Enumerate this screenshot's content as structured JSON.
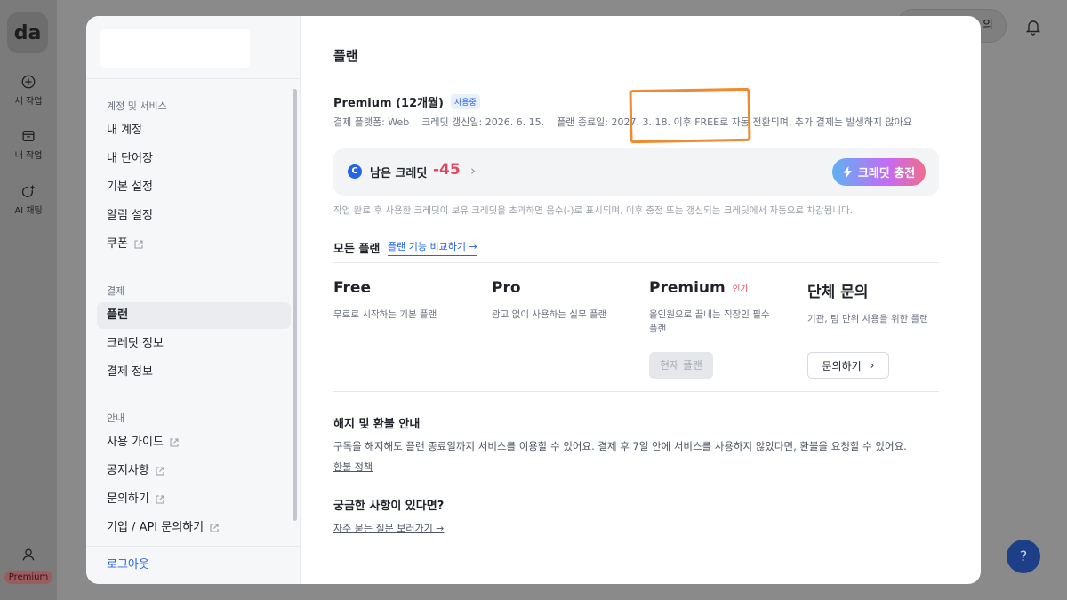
{
  "app": {
    "logo_text": "da",
    "rail": [
      {
        "label": "새 작업",
        "icon": "plus-circle-icon"
      },
      {
        "label": "내 작업",
        "icon": "archive-icon"
      },
      {
        "label": "AI 채팅",
        "icon": "sparkle-chat-icon"
      }
    ],
    "plan_badge": "Premium",
    "top_pill_text": "의"
  },
  "sidebar": {
    "sections": [
      {
        "title": "계정 및 서비스",
        "items": [
          {
            "label": "내 계정",
            "external": false
          },
          {
            "label": "내 단어장",
            "external": false
          },
          {
            "label": "기본 설정",
            "external": false
          },
          {
            "label": "알림 설정",
            "external": false
          },
          {
            "label": "쿠폰",
            "external": true
          }
        ]
      },
      {
        "title": "결제",
        "items": [
          {
            "label": "플랜",
            "external": false,
            "active": true
          },
          {
            "label": "크레딧 정보",
            "external": false
          },
          {
            "label": "결제 정보",
            "external": false
          }
        ]
      },
      {
        "title": "안내",
        "items": [
          {
            "label": "사용 가이드",
            "external": true
          },
          {
            "label": "공지사항",
            "external": true
          },
          {
            "label": "문의하기",
            "external": true
          },
          {
            "label": "기업 / API 문의하기",
            "external": true
          }
        ]
      }
    ],
    "logout": "로그아웃"
  },
  "main": {
    "title": "플랜",
    "current_plan": {
      "name": "Premium (12개월)",
      "badge": "사용중",
      "platform": "결제 플랫폼: Web",
      "renewal": "크레딧 갱신일: 2026. 6. 15.",
      "end": "플랜 종료일: 2027. 3. 18. 이후 FREE로 자동 전환되며, 추가 결제는 발생하지 않아요"
    },
    "credit": {
      "icon_letter": "C",
      "label": "남은 크레딧",
      "value": "-45",
      "charge_button": "크레딧 충전",
      "note": "작업 완료 후 사용한 크레딧이 보유 크레딧을 초과하면 음수(-)로 표시되며, 이후 충전 또는 갱신되는 크레딧에서 자동으로 차감됩니다."
    },
    "all_plans": {
      "title": "모든 플랜",
      "compare_link": "플랜 기능 비교하기 →",
      "plans": [
        {
          "name": "Free",
          "desc": "무료로 시작하는 기본 플랜"
        },
        {
          "name": "Pro",
          "desc": "광고 없이 사용하는 실무 플랜"
        },
        {
          "name": "Premium",
          "tag": "인기",
          "desc": "올인원으로 끝내는 직장인 필수 플랜",
          "button": "현재 플랜"
        },
        {
          "name": "단체 문의",
          "desc": "기관, 팀 단위 사용을 위한 플랜",
          "button": "문의하기"
        }
      ]
    },
    "refund": {
      "title": "해지 및 환불 안내",
      "text": "구독을 해지해도 플랜 종료일까지 서비스를 이용할 수 있어요. 결제 후 7일 안에 서비스를 사용하지 않았다면, 환불을 요청할 수 있어요.",
      "link": "환불 정책"
    },
    "faq": {
      "title": "궁금한 사항이 있다면?",
      "link": "자주 묻는 질문 보러가기 →"
    }
  },
  "help_button": "?",
  "colors": {
    "accent": "#2563eb",
    "negative": "#e2465c",
    "annotation": "#f08a2e"
  }
}
